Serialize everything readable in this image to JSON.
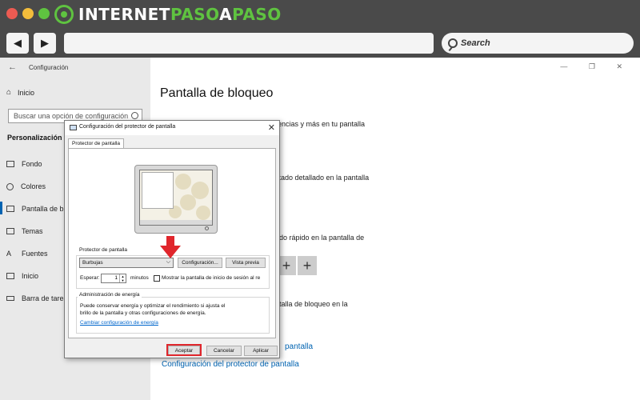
{
  "brand": {
    "part1": "INTERNET",
    "part2": "PASO",
    "part3": "A",
    "part4": "PASO",
    "green": "#5fc340"
  },
  "browser": {
    "back_icon": "◀",
    "forward_icon": "▶",
    "search_placeholder": "Search"
  },
  "settings": {
    "back_icon": "←",
    "title": "Configuración",
    "home_label": "Inicio",
    "search_placeholder": "Buscar una opción de configuración",
    "section": "Personalización",
    "items": [
      {
        "label": "Fondo"
      },
      {
        "label": "Colores"
      },
      {
        "label": "Pantalla de blo"
      },
      {
        "label": "Temas"
      },
      {
        "label": "Fuentes"
      },
      {
        "label": "Inicio"
      },
      {
        "label": "Barra de tarea"
      }
    ],
    "window_controls": "— ❐ ✕",
    "accent": "#0063b1"
  },
  "main": {
    "title": "Pantalla de bloqueo",
    "text1": "rencias y más en tu pantalla",
    "text2": "stado detallado en la pantalla",
    "text3": "ado rápido en la pantalla de",
    "text4": "ntalla de bloqueo en la",
    "plus": "+",
    "link_partial": "pantalla",
    "link_screensaver": "Configuración del protector de pantalla"
  },
  "dialog": {
    "title": "Configuración del protector de pantalla",
    "close": "✕",
    "tab": "Protector de pantalla",
    "screensaver_group": "Protector de pantalla",
    "selected": "Burbujas",
    "caret": "⌵",
    "config_button": "Configuración...",
    "preview_button": "Vista previa",
    "wait_label": "Esperar:",
    "wait_value": "1",
    "minutes_label": "minutos",
    "login_checkbox_label": "Mostrar la pantalla de inicio de sesión al re",
    "energy_group": "Administración de energía",
    "energy_text_1": "Puede conservar energía y optimizar el rendimiento si ajusta el",
    "energy_text_2": "brillo de la pantalla y otras configuraciones de energía.",
    "energy_link": "Cambiar configuración de energía",
    "ok_button": "Aceptar",
    "cancel_button": "Cancelar",
    "apply_button": "Aplicar",
    "highlight_color": "#e0262c"
  }
}
